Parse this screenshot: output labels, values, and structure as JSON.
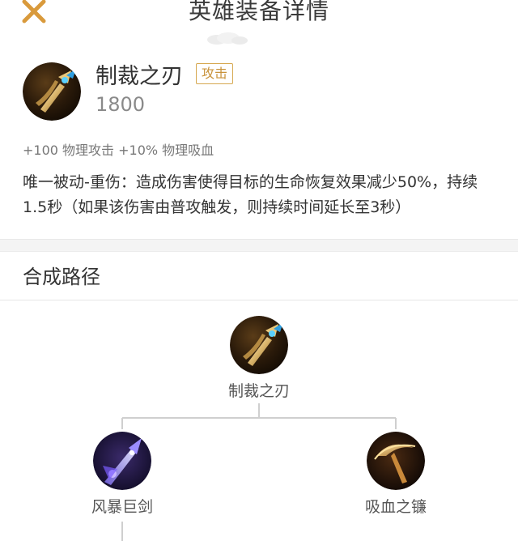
{
  "header": {
    "title": "英雄装备详情",
    "close_icon": "close-icon",
    "accent_color": "#d99a3c"
  },
  "item": {
    "name": "制裁之刃",
    "tag": "攻击",
    "price": "1800",
    "icon": "sword-icon",
    "stats": "+100 物理攻击 +10% 物理吸血",
    "description": "唯一被动-重伤：造成伤害使得目标的生命恢复效果减少50%，持续1.5秒（如果该伤害由普攻触发，则持续时间延长至3秒）"
  },
  "recipe": {
    "title": "合成路径",
    "root": {
      "name": "制裁之刃",
      "icon": "sword-icon"
    },
    "components": [
      {
        "name": "风暴巨剑",
        "icon": "storm-sword-icon"
      },
      {
        "name": "吸血之镰",
        "icon": "sickle-icon"
      }
    ]
  }
}
